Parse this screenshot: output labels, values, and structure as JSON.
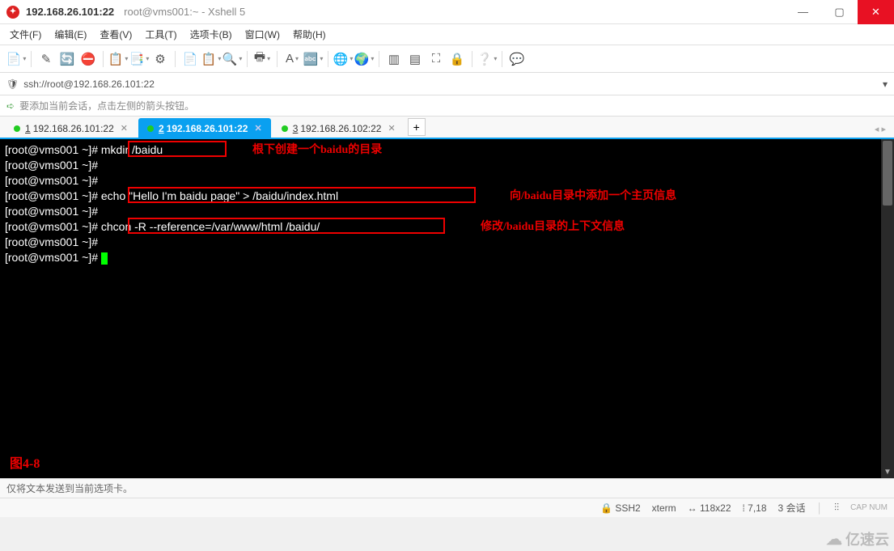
{
  "title": {
    "main": "192.168.26.101:22",
    "sub": "root@vms001:~ - Xshell 5"
  },
  "window_buttons": {
    "min": "—",
    "max": "▢",
    "close": "✕"
  },
  "menus": [
    "文件(F)",
    "编辑(E)",
    "查看(V)",
    "工具(T)",
    "选项卡(B)",
    "窗口(W)",
    "帮助(H)"
  ],
  "toolbar_icons": [
    {
      "name": "new-session-icon",
      "glyph": "📄",
      "drop": true
    },
    {
      "name": "sep"
    },
    {
      "name": "edit-icon",
      "glyph": "✎"
    },
    {
      "name": "reconnect-icon",
      "glyph": "🔄"
    },
    {
      "name": "disconnect-icon",
      "glyph": "⛔"
    },
    {
      "name": "sep"
    },
    {
      "name": "file-transfer-icon",
      "glyph": "📋",
      "drop": true
    },
    {
      "name": "transfer-icon",
      "glyph": "📑",
      "drop": true
    },
    {
      "name": "properties-icon",
      "glyph": "⚙"
    },
    {
      "name": "sep"
    },
    {
      "name": "copy-icon",
      "glyph": "📄"
    },
    {
      "name": "paste-icon",
      "glyph": "📋",
      "drop": true
    },
    {
      "name": "find-icon",
      "glyph": "🔍",
      "drop": true
    },
    {
      "name": "sep"
    },
    {
      "name": "print-icon",
      "glyph": "🖶",
      "drop": true
    },
    {
      "name": "sep"
    },
    {
      "name": "font-color-icon",
      "glyph": "A",
      "drop": true
    },
    {
      "name": "zoom-icon",
      "glyph": "🔤",
      "drop": true
    },
    {
      "name": "sep"
    },
    {
      "name": "globe-icon",
      "glyph": "🌐",
      "drop": true
    },
    {
      "name": "globe2-icon",
      "glyph": "🌍",
      "drop": true
    },
    {
      "name": "sep"
    },
    {
      "name": "panel-icon",
      "glyph": "▥"
    },
    {
      "name": "panel2-icon",
      "glyph": "▤"
    },
    {
      "name": "fullscreen-icon",
      "glyph": "⛶"
    },
    {
      "name": "lock-icon",
      "glyph": "🔒"
    },
    {
      "name": "sep"
    },
    {
      "name": "help-icon",
      "glyph": "❔",
      "drop": true
    },
    {
      "name": "sep"
    },
    {
      "name": "feedback-icon",
      "glyph": "💬"
    }
  ],
  "address": {
    "url": "ssh://root@192.168.26.101:22"
  },
  "hint": "要添加当前会话，点击左侧的箭头按钮。",
  "tabs": [
    {
      "num": "1",
      "label": "192.168.26.101:22",
      "active": false
    },
    {
      "num": "2",
      "label": "192.168.26.101:22",
      "active": true
    },
    {
      "num": "3",
      "label": "192.168.26.102:22",
      "active": false
    }
  ],
  "terminal_lines": [
    {
      "prompt": "[root@vms001 ~]# ",
      "cmd": "mkdir /baidu"
    },
    {
      "prompt": "[root@vms001 ~]# ",
      "cmd": ""
    },
    {
      "prompt": "[root@vms001 ~]# ",
      "cmd": ""
    },
    {
      "prompt": "[root@vms001 ~]# ",
      "cmd": "echo \"Hello I'm baidu page\" > /baidu/index.html"
    },
    {
      "prompt": "[root@vms001 ~]# ",
      "cmd": ""
    },
    {
      "prompt": "[root@vms001 ~]# ",
      "cmd": "chcon -R --reference=/var/www/html /baidu/"
    },
    {
      "prompt": "[root@vms001 ~]# ",
      "cmd": ""
    },
    {
      "prompt": "[root@vms001 ~]# ",
      "cmd": "",
      "cursor": true
    }
  ],
  "annotations": {
    "a1": "根下创建一个baidu的目录",
    "a2": "向/baidu目录中添加一个主页信息",
    "a3": "修改/baidu目录的上下文信息",
    "fig": "图4-8"
  },
  "footer1": "仅将文本发送到当前选项卡。",
  "statusbar": {
    "ssh": "SSH2",
    "term": "xterm",
    "size": "118x22",
    "pos": "7,18",
    "sessions": "3 会话"
  },
  "watermark": "亿速云"
}
